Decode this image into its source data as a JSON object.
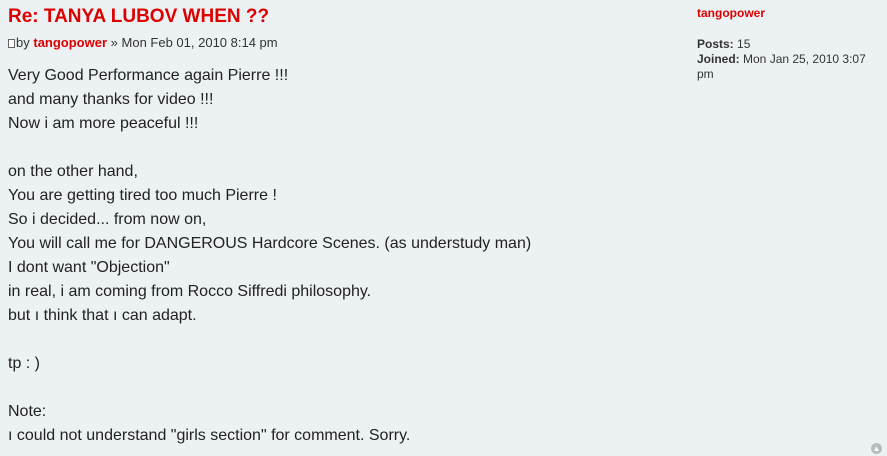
{
  "post": {
    "title": "Re: TANYA LUBOV WHEN ??",
    "by_label": "by",
    "author": "tangopower",
    "separator": "»",
    "datetime": "Mon Feb 01, 2010 8:14 pm",
    "body_lines": [
      "Very Good Performance again Pierre !!!",
      "and many thanks for video !!!",
      "Now i am more peaceful !!!",
      "",
      "on the other hand,",
      "You are getting tired too much Pierre !",
      "So i decided... from now on,",
      "You will call me for DANGEROUS Hardcore Scenes. (as understudy man)",
      "I dont want \"Objection\"",
      "in real, i am coming from Rocco Siffredi philosophy.",
      "but ı think that ı can adapt.",
      "",
      "tp : )",
      "",
      "Note:",
      "ı could not understand \"girls section\" for comment. Sorry."
    ]
  },
  "profile": {
    "author": "tangopower",
    "posts_label": "Posts:",
    "posts_value": "15",
    "joined_label": "Joined:",
    "joined_value": "Mon Jan 25, 2010 3:07 pm"
  },
  "icons": {
    "post_icon": "post-icon",
    "top_icon": "back-to-top-icon"
  },
  "colors": {
    "background": "#ecf1f3",
    "accent": "#dd0000"
  }
}
